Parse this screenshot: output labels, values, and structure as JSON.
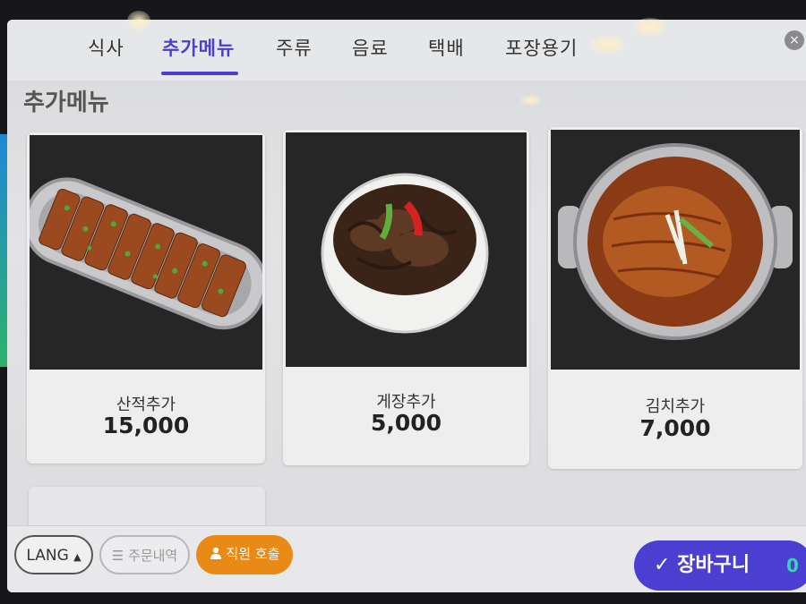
{
  "tabs": [
    {
      "label": "식사"
    },
    {
      "label": "추가메뉴"
    },
    {
      "label": "주류"
    },
    {
      "label": "음료"
    },
    {
      "label": "택배"
    },
    {
      "label": "포장용기"
    }
  ],
  "close_symbol": "×",
  "section_title": "추가메뉴",
  "menu_items": [
    {
      "name": "산적추가",
      "price": "15,000",
      "photo": "grilled-skewers"
    },
    {
      "name": "게장추가",
      "price": "5,000",
      "photo": "marinated-crab-bowl"
    },
    {
      "name": "김치추가",
      "price": "7,000",
      "photo": "kimchi-pot"
    }
  ],
  "bottom": {
    "lang_label": "LANG",
    "orders_label": "주문내역",
    "staff_label": "직원 호출",
    "cart_label": "장바구니",
    "cart_count": "0"
  },
  "colors": {
    "accent": "#4a3fd0",
    "staff_call": "#e98a17",
    "cart_count": "#38d3b6"
  }
}
